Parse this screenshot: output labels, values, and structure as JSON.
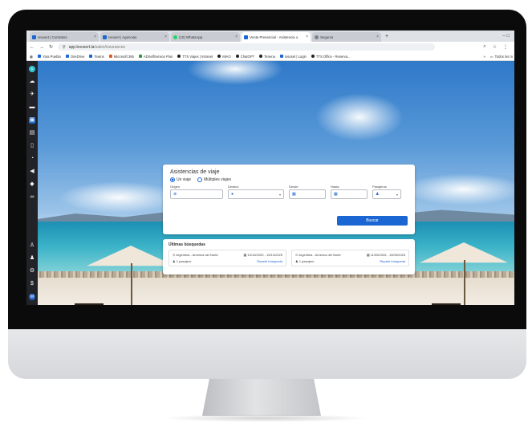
{
  "browser": {
    "tabs": [
      {
        "label": "Ixsoset | Contratos",
        "active": false,
        "icon": "site-icon"
      },
      {
        "label": "Ixsoset | Agencias",
        "active": false,
        "icon": "site-icon"
      },
      {
        "label": "(10) WhatsApp",
        "active": false,
        "icon": "whatsapp-icon"
      },
      {
        "label": "Venta Presencial - Asistencia o",
        "active": true,
        "icon": "site-icon"
      },
      {
        "label": "Seguros",
        "active": false,
        "icon": "globe-icon"
      }
    ],
    "new_tab": "+",
    "window_controls": "–   □",
    "url_domain": "app.boosert.la",
    "url_path": "/sales/insurances",
    "addr_icons": [
      "⌕",
      "☆",
      "⋮"
    ],
    "bookmarks": [
      {
        "label": "Yara Puebla",
        "dot": "b"
      },
      {
        "label": "OneDrive",
        "dot": "b"
      },
      {
        "label": "Teams",
        "dot": "b"
      },
      {
        "label": "Microsoft 365",
        "dot": "o"
      },
      {
        "label": "ADSelfService Plus",
        "dot": "g"
      },
      {
        "label": "TTS Viajes | Intranet",
        "dot": "k"
      },
      {
        "label": "MiAO",
        "dot": "k"
      },
      {
        "label": "ChatGPT",
        "dot": "k"
      },
      {
        "label": "Tenena",
        "dot": "k"
      },
      {
        "label": "Ixsoset | Login",
        "dot": "b"
      },
      {
        "label": "TTS Office - Reserva...",
        "dot": "k"
      }
    ],
    "bookmarks_more": "»",
    "all_bookmarks": "Todos los m"
  },
  "sidebar": {
    "logo_text": "b",
    "icons": [
      "cloud-icon",
      "plane-icon",
      "car-icon",
      "briefcase-icon",
      "building-icon",
      "document-icon",
      "pie-chart-icon",
      "megaphone-icon",
      "tag-icon",
      "infinity-icon"
    ],
    "bottom_icons": [
      "user-plus-icon",
      "team-icon",
      "gear-icon",
      "currency-icon"
    ],
    "avatar_letter": "M"
  },
  "form": {
    "title": "Asistencias de viaje",
    "trip_options": [
      "Un viaje",
      "Múltiples viajes"
    ],
    "selected_trip": "Un viaje",
    "fields": {
      "origin_label": "Origen",
      "destination_label": "Destino",
      "from_label": "Desde",
      "to_label": "Hasta",
      "passengers_label": "Pasajeros"
    },
    "search_button": "Buscar"
  },
  "recent": {
    "title": "Últimas búsquedas",
    "items": [
      {
        "route": "Argentina - America del Norte",
        "dates": "10/10/2025 - 15/10/2025",
        "passengers": "1 pasajero",
        "action": "Repetir búsqueda"
      },
      {
        "route": "Argentina - America del Norte",
        "dates": "11/05/2026 - 10/05/2026",
        "passengers": "1 pasajero",
        "action": "Repetir búsqueda"
      }
    ]
  }
}
